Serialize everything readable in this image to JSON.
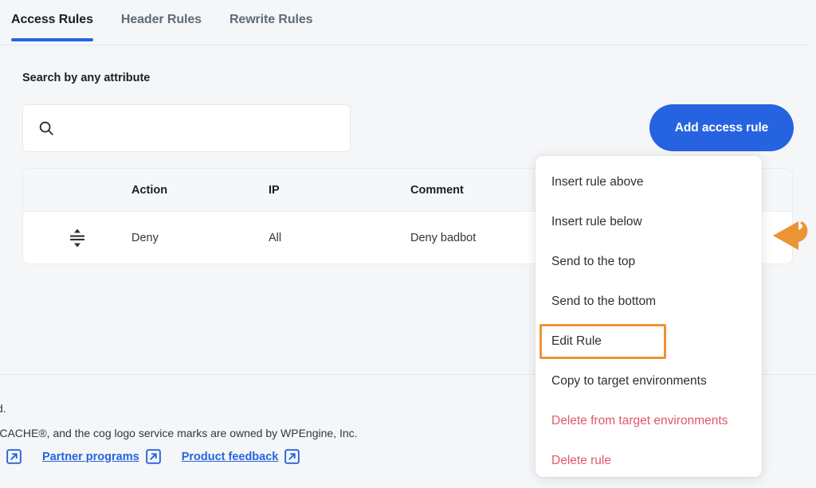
{
  "tabs": [
    {
      "label": "Access Rules",
      "active": true
    },
    {
      "label": "Header Rules",
      "active": false
    },
    {
      "label": "Rewrite Rules",
      "active": false
    }
  ],
  "search": {
    "label": "Search by any attribute",
    "value": "",
    "placeholder": "",
    "icon": "search-icon"
  },
  "actions": {
    "add_access_rule": "Add access rule"
  },
  "table": {
    "columns": [
      "",
      "Action",
      "IP",
      "Comment"
    ],
    "rows": [
      {
        "handle_icon": "drag-handle-icon",
        "action": "Deny",
        "ip": "All",
        "comment": "Deny badbot"
      }
    ]
  },
  "context_menu": {
    "items": [
      {
        "label": "Insert rule above",
        "danger": false,
        "highlighted": false
      },
      {
        "label": "Insert rule below",
        "danger": false,
        "highlighted": false
      },
      {
        "label": "Send to the top",
        "danger": false,
        "highlighted": false
      },
      {
        "label": "Send to the bottom",
        "danger": false,
        "highlighted": false
      },
      {
        "label": "Edit Rule",
        "danger": false,
        "highlighted": true
      },
      {
        "label": "Copy to target environments",
        "danger": false,
        "highlighted": false
      },
      {
        "label": "Delete from target environments",
        "danger": true,
        "highlighted": false
      },
      {
        "label": "Delete rule",
        "danger": true,
        "highlighted": false
      }
    ]
  },
  "annotation": {
    "arrow_icon": "curved-arrow-left-icon",
    "color": "#eb9434"
  },
  "footer": {
    "line1": "d.",
    "line2": "/ERCACHE®, and the cog logo service marks are owned by WPEngine, Inc.",
    "links": [
      {
        "label": "Partner programs",
        "icon": "external-link-icon"
      },
      {
        "label": "Product feedback",
        "icon": "external-link-icon"
      }
    ]
  },
  "colors": {
    "accent_blue": "#2663e0",
    "danger_red": "#e2566c",
    "highlight_orange": "#eb9434",
    "page_bg": "#f4f6f8"
  }
}
